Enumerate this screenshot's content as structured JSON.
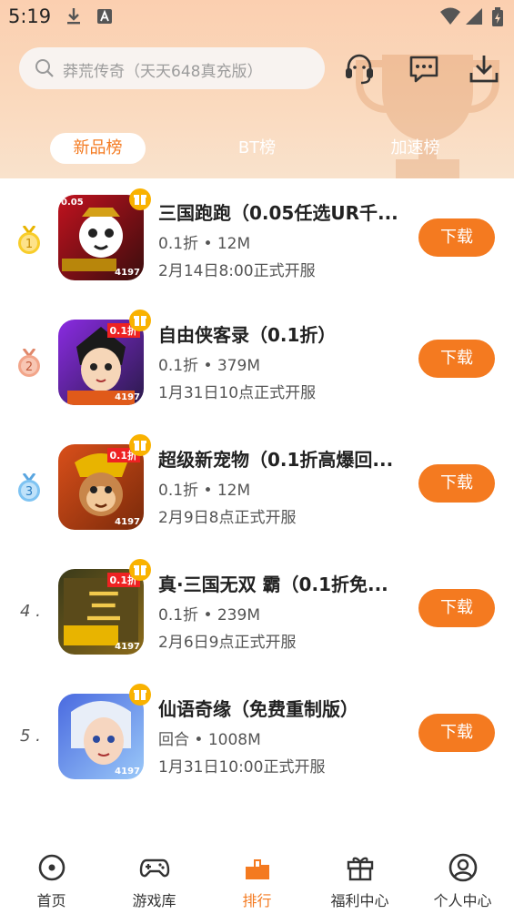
{
  "status_bar": {
    "time": "5:19"
  },
  "header": {
    "search_placeholder": "莽荒传奇（天天648真充版）",
    "icons": [
      "headset-icon",
      "chat-icon",
      "download-icon"
    ]
  },
  "tabs": [
    {
      "label": "新品榜",
      "active": true
    },
    {
      "label": "BT榜",
      "active": false
    },
    {
      "label": "加速榜",
      "active": false
    }
  ],
  "games": [
    {
      "rank": "1",
      "medal": "gold",
      "title": "三国跑跑（0.05任选UR千...",
      "meta": "0.1折 • 12M",
      "open_time": "2月14日8:00正式开服",
      "button": "下载",
      "icon_badge": "4197",
      "icon_corner": "0.05"
    },
    {
      "rank": "2",
      "medal": "bronze",
      "title": "自由侠客录（0.1折）",
      "meta": "0.1折 • 379M",
      "open_time": "1月31日10点正式开服",
      "button": "下载",
      "icon_badge": "4197",
      "icon_corner": "0.1折"
    },
    {
      "rank": "3",
      "medal": "blue",
      "title": "超级新宠物（0.1折高爆回...",
      "meta": "0.1折 • 12M",
      "open_time": "2月9日8点正式开服",
      "button": "下载",
      "icon_badge": "4197",
      "icon_corner": "0.1折"
    },
    {
      "rank": "4 .",
      "medal": "",
      "title": "真·三国无双 霸（0.1折免...",
      "meta": "0.1折 • 239M",
      "open_time": "2月6日9点正式开服",
      "button": "下载",
      "icon_badge": "4197",
      "icon_corner": "0.1折"
    },
    {
      "rank": "5 .",
      "medal": "",
      "title": "仙语奇缘（免费重制版）",
      "meta": "回合 • 1008M",
      "open_time": "1月31日10:00正式开服",
      "button": "下载",
      "icon_badge": "4197",
      "icon_corner": ""
    }
  ],
  "bottom_nav": [
    {
      "label": "首页",
      "icon": "home-icon",
      "active": false
    },
    {
      "label": "游戏库",
      "icon": "gamepad-icon",
      "active": false
    },
    {
      "label": "排行",
      "icon": "ranking-icon",
      "active": true
    },
    {
      "label": "福利中心",
      "icon": "gift-box-icon",
      "active": false
    },
    {
      "label": "个人中心",
      "icon": "user-icon",
      "active": false
    }
  ],
  "colors": {
    "accent": "#f47a20",
    "header_bg": "#fbcfb0",
    "text": "#222222",
    "subtext": "#555555"
  }
}
